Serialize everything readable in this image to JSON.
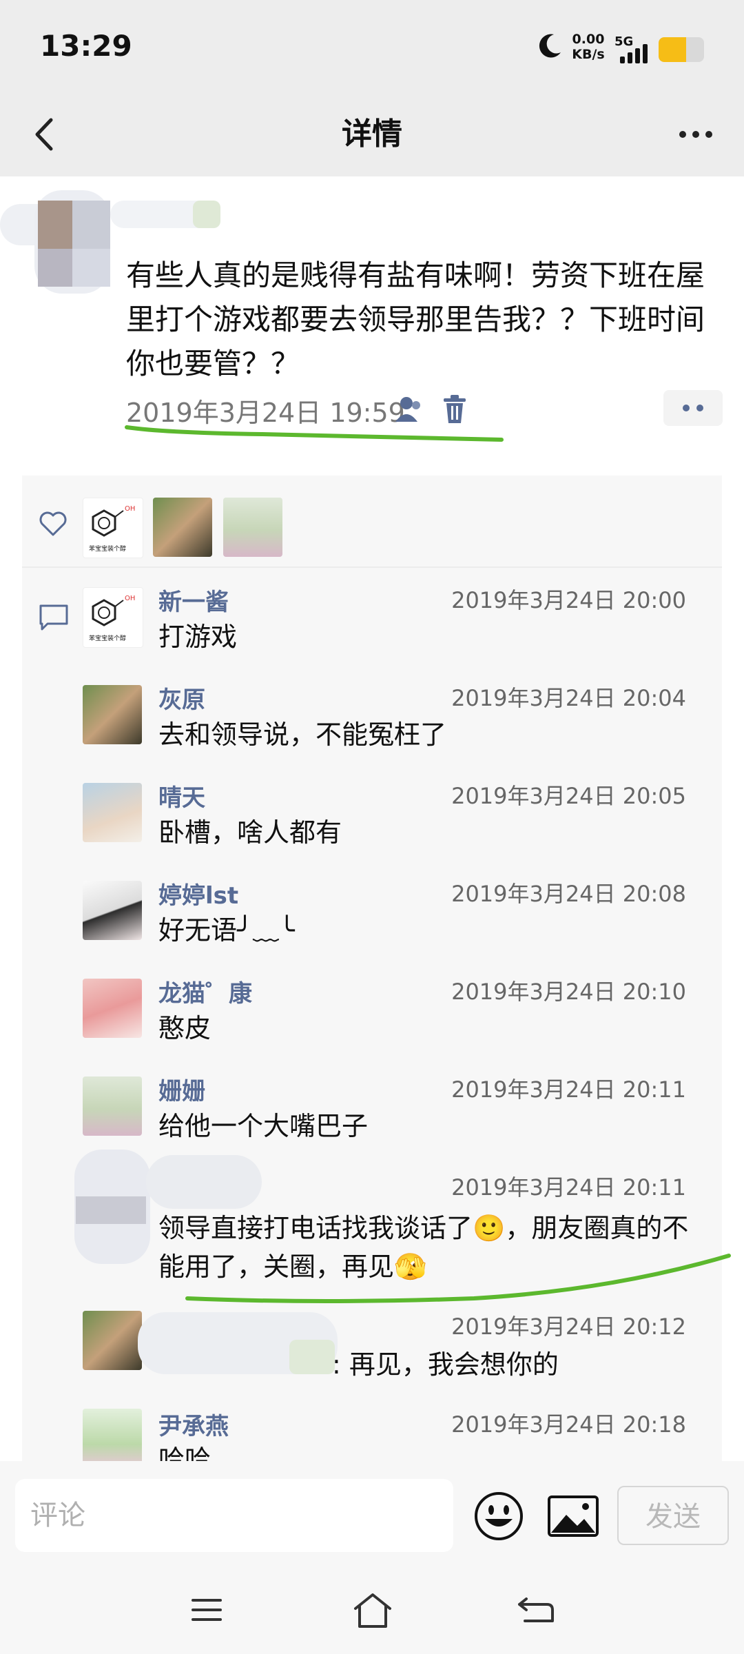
{
  "status_bar": {
    "time": "13:29",
    "net_speed_value": "0.00",
    "net_speed_unit": "KB/s",
    "network": "5G",
    "battery_level": 0.6,
    "battery_color": "#f6bd16",
    "icons": [
      "moon-icon",
      "signal-icon",
      "battery-icon"
    ]
  },
  "nav": {
    "back_icon": "chevron-left-icon",
    "title": "详情",
    "more_icon": "more-icon"
  },
  "post": {
    "text": "有些人真的是贱得有盐有味啊！劳资下班在屋里打个游戏都要去领导那里告我？？下班时间你也要管？？",
    "timestamp": "2019年3月24日 19:59",
    "icons": [
      "visibility-icon",
      "trash-icon",
      "more-dots-icon"
    ]
  },
  "likes": {
    "icon": "heart-icon"
  },
  "comments": [
    {
      "name": "新一酱",
      "time": "2019年3月24日 20:00",
      "text": "打游戏"
    },
    {
      "name": "灰原",
      "time": "2019年3月24日 20:04",
      "text": "去和领导说，不能冤枉了"
    },
    {
      "name": "晴天",
      "time": "2019年3月24日 20:05",
      "text": "卧槽，啥人都有"
    },
    {
      "name": "婷婷lst",
      "time": "2019年3月24日 20:08",
      "text": "好无语╯﹏╰"
    },
    {
      "name": "龙猫゜康",
      "time": "2019年3月24日 20:10",
      "text": "憨皮"
    },
    {
      "name": "姗姗",
      "time": "2019年3月24日 20:11",
      "text": "给他一个大嘴巴子"
    },
    {
      "name": "",
      "time": "2019年3月24日 20:11",
      "text": "领导直接打电话找我谈话了🙂，朋友圈真的不能用了，关圈，再见🫣"
    },
    {
      "name": "",
      "time": "2019年3月24日 20:12",
      "text": ": 再见，我会想你的"
    },
    {
      "name": "尹承燕",
      "time": "2019年3月24日 20:18",
      "text": "哈哈"
    }
  ],
  "avatar_caption": "苯宝宝装个醇",
  "input_bar": {
    "placeholder": "评论",
    "emoji_icon": "emoji-icon",
    "image_icon": "image-icon",
    "send_label": "发送"
  },
  "gesture_nav": {
    "icons": [
      "menu-icon",
      "home-icon",
      "back-icon"
    ]
  },
  "colors": {
    "accent_name": "#576b95",
    "highlight": "#5cb82e"
  }
}
